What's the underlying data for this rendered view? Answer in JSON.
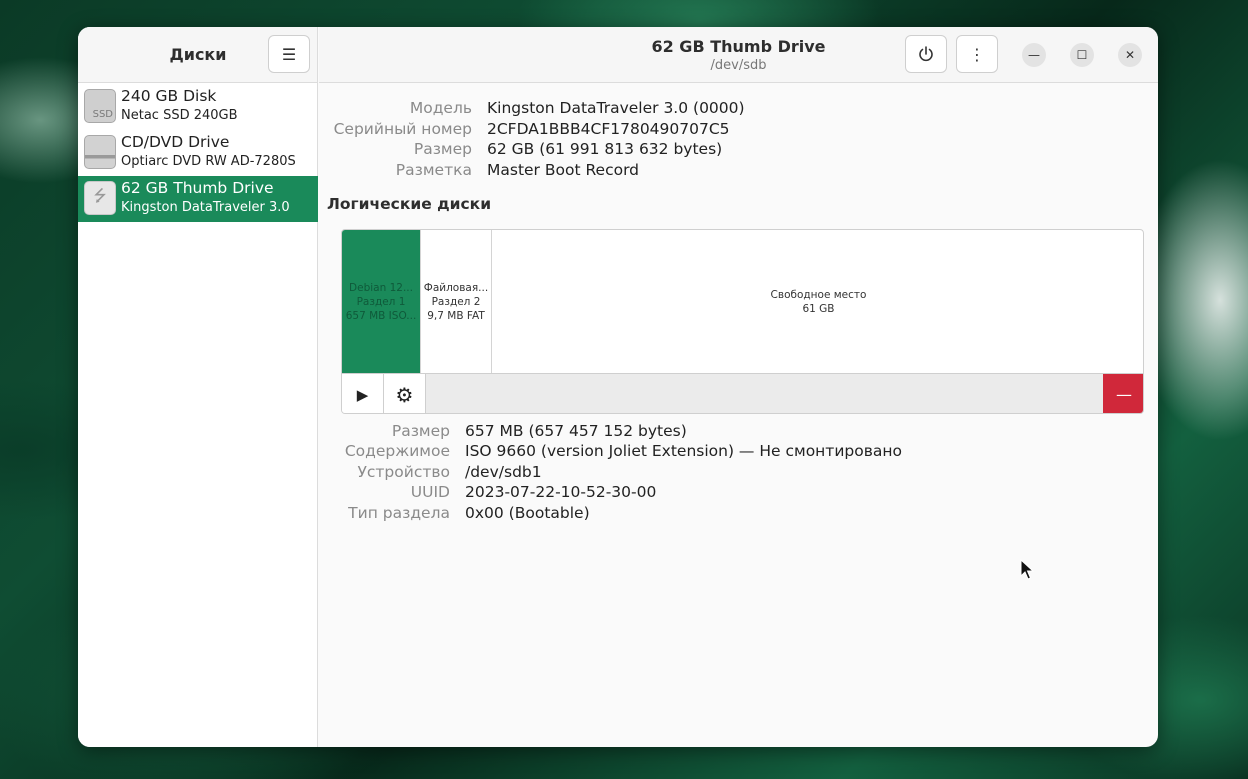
{
  "sidebar": {
    "title": "Диски",
    "drives": [
      {
        "name": "240 GB Disk",
        "model": "Netac SSD 240GB",
        "icon": "ssd-icon",
        "icon_text": "SSD"
      },
      {
        "name": "CD/DVD Drive",
        "model": "Optiarc DVD RW AD-7280S",
        "icon": "optical-drive-icon"
      },
      {
        "name": "62 GB Thumb Drive",
        "model": "Kingston DataTraveler 3.0",
        "icon": "usb-drive-icon",
        "selected": true
      }
    ]
  },
  "header": {
    "title": "62 GB Thumb Drive",
    "subtitle": "/dev/sdb"
  },
  "disk_info": {
    "model_label": "Модель",
    "model_value": "Kingston DataTraveler 3.0 (0000)",
    "serial_label": "Серийный номер",
    "serial_value": "2CFDA1BBB4CF1780490707C5",
    "size_label": "Размер",
    "size_value": "62 GB (61 991 813 632 bytes)",
    "partitioning_label": "Разметка",
    "partitioning_value": "Master Boot Record"
  },
  "volumes": {
    "section_title": "Логические диски",
    "segments": [
      {
        "line1": "Debian 12...",
        "line2": "Раздел 1",
        "line3": "657 MB ISO..."
      },
      {
        "line1": "Файловая...",
        "line2": "Раздел 2",
        "line3": "9,7 MB FAT"
      },
      {
        "line1": "Свободное место",
        "line2": "61 GB"
      }
    ]
  },
  "partition_info": {
    "size_label": "Размер",
    "size_value": "657 MB (657 457 152 bytes)",
    "content_label": "Содержимое",
    "content_value": "ISO 9660 (version Joliet Extension) — Не смонтировано",
    "device_label": "Устройство",
    "device_value": "/dev/sdb1",
    "uuid_label": "UUID",
    "uuid_value": "2023-07-22-10-52-30-00",
    "type_label": "Тип раздела",
    "type_value": "0x00 (Bootable)"
  },
  "colors": {
    "accent": "#1a8a5a",
    "danger": "#d0283a"
  }
}
